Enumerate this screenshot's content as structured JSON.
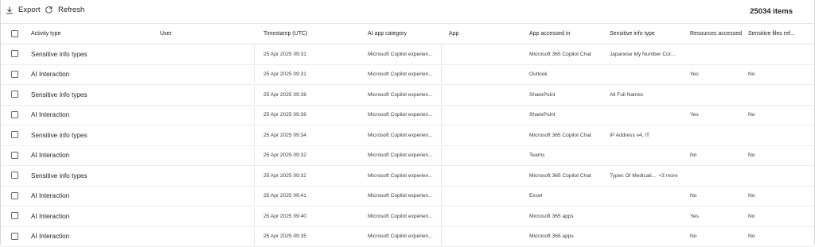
{
  "toolbar": {
    "export_label": "Export",
    "refresh_label": "Refresh",
    "item_count": "25034 items",
    "export_icon": "download-icon",
    "refresh_icon": "refresh-icon"
  },
  "columns": [
    "Activity type",
    "User",
    "Timestamp (UTC)",
    "AI app category",
    "App",
    "App accessed in",
    "Sensitive info type",
    "Resources accessed",
    "Sensitive files ref..."
  ],
  "rows": [
    {
      "activity": "Sensitive info types",
      "user": "",
      "timestamp": "25 Apr 2025 09:31",
      "category": "Microsoft Copilot experien...",
      "app": "",
      "accessed_in": "Microsoft 365 Copilot Chat",
      "info_type": "Japanese My Number Cor...",
      "more": "",
      "resources": "",
      "files": ""
    },
    {
      "activity": "AI Interaction",
      "user": "",
      "timestamp": "25 Apr 2025 09:31",
      "category": "Microsoft Copilot experien...",
      "app": "",
      "accessed_in": "Outlook",
      "info_type": "",
      "more": "",
      "resources": "Yes",
      "files": "No"
    },
    {
      "activity": "Sensitive info types",
      "user": "",
      "timestamp": "25 Apr 2025 09:38",
      "category": "Microsoft Copilot experien...",
      "app": "",
      "accessed_in": "SharePoint",
      "info_type": "All Full Names",
      "more": "",
      "resources": "",
      "files": ""
    },
    {
      "activity": "AI Interaction",
      "user": "",
      "timestamp": "25 Apr 2025 09:38",
      "category": "Microsoft Copilot experien...",
      "app": "",
      "accessed_in": "SharePoint",
      "info_type": "",
      "more": "",
      "resources": "Yes",
      "files": "No"
    },
    {
      "activity": "Sensitive info types",
      "user": "",
      "timestamp": "25 Apr 2025 09:34",
      "category": "Microsoft Copilot experien...",
      "app": "",
      "accessed_in": "Microsoft 365 Copilot Chat",
      "info_type": "IP Address v4, IT",
      "more": "",
      "resources": "",
      "files": ""
    },
    {
      "activity": "AI Interaction",
      "user": "",
      "timestamp": "25 Apr 2025 09:32",
      "category": "Microsoft Copilot experien...",
      "app": "",
      "accessed_in": "Teams",
      "info_type": "",
      "more": "",
      "resources": "No",
      "files": "No"
    },
    {
      "activity": "Sensitive info types",
      "user": "",
      "timestamp": "25 Apr 2025 09:32",
      "category": "Microsoft Copilot experien...",
      "app": "",
      "accessed_in": "Microsoft 365 Copilot Chat",
      "info_type": "Types Of Medicati...",
      "more": "+3 more",
      "resources": "",
      "files": ""
    },
    {
      "activity": "AI Interaction",
      "user": "",
      "timestamp": "25 Apr 2025 09:41",
      "category": "Microsoft Copilot experien...",
      "app": "",
      "accessed_in": "Excel",
      "info_type": "",
      "more": "",
      "resources": "No",
      "files": "No"
    },
    {
      "activity": "AI Interaction",
      "user": "",
      "timestamp": "25 Apr 2025 09:40",
      "category": "Microsoft Copilot experien...",
      "app": "",
      "accessed_in": "Microsoft 365 apps",
      "info_type": "",
      "more": "",
      "resources": "Yes",
      "files": "No"
    },
    {
      "activity": "AI Interaction",
      "user": "",
      "timestamp": "25 Apr 2025 09:35",
      "category": "Microsoft Copilot experien...",
      "app": "",
      "accessed_in": "Microsoft 365 apps",
      "info_type": "",
      "more": "",
      "resources": "No",
      "files": "No"
    }
  ]
}
